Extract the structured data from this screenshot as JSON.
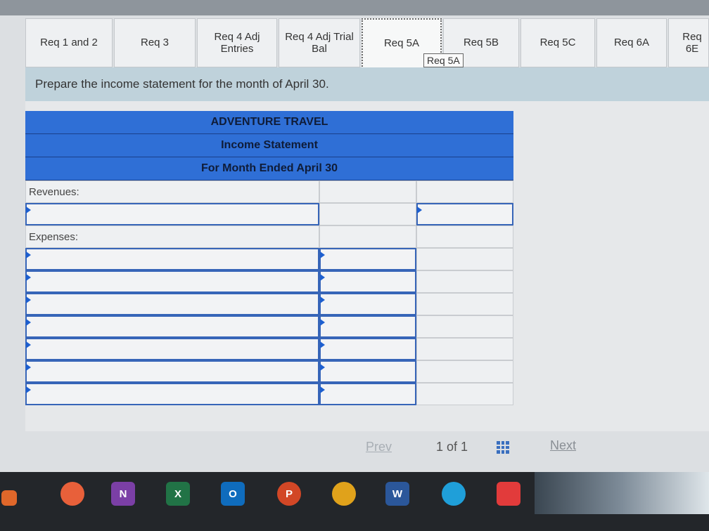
{
  "tabs": [
    {
      "label": "Req 1 and 2"
    },
    {
      "label": "Req 3"
    },
    {
      "label": "Req 4 Adj Entries"
    },
    {
      "label": "Req 4 Adj Trial Bal"
    },
    {
      "label": "Req 5A"
    },
    {
      "label": "Req 5B"
    },
    {
      "label": "Req 5C"
    },
    {
      "label": "Req 6A"
    },
    {
      "label": "Req 6E"
    }
  ],
  "tooltip": "Req 5A",
  "instruction": "Prepare the income statement for the month of April 30.",
  "statement": {
    "company": "ADVENTURE TRAVEL",
    "title": "Income Statement",
    "period": "For Month Ended April 30",
    "revenues_label": "Revenues:",
    "expenses_label": "Expenses:"
  },
  "nav": {
    "prev": "Prev",
    "page": "1 of 1",
    "next": "Next"
  },
  "taskbar": [
    {
      "icon": "onenote-icon",
      "label": "N"
    },
    {
      "icon": "excel-icon",
      "label": "X"
    },
    {
      "icon": "outlook-icon",
      "label": "O"
    },
    {
      "icon": "powerpoint-icon",
      "label": "P"
    },
    {
      "icon": "word-icon",
      "label": "W"
    }
  ],
  "colors": {
    "header_blue": "#2f6fd6",
    "input_border": "#3765b8",
    "instruction_bg": "#bfd2db"
  }
}
